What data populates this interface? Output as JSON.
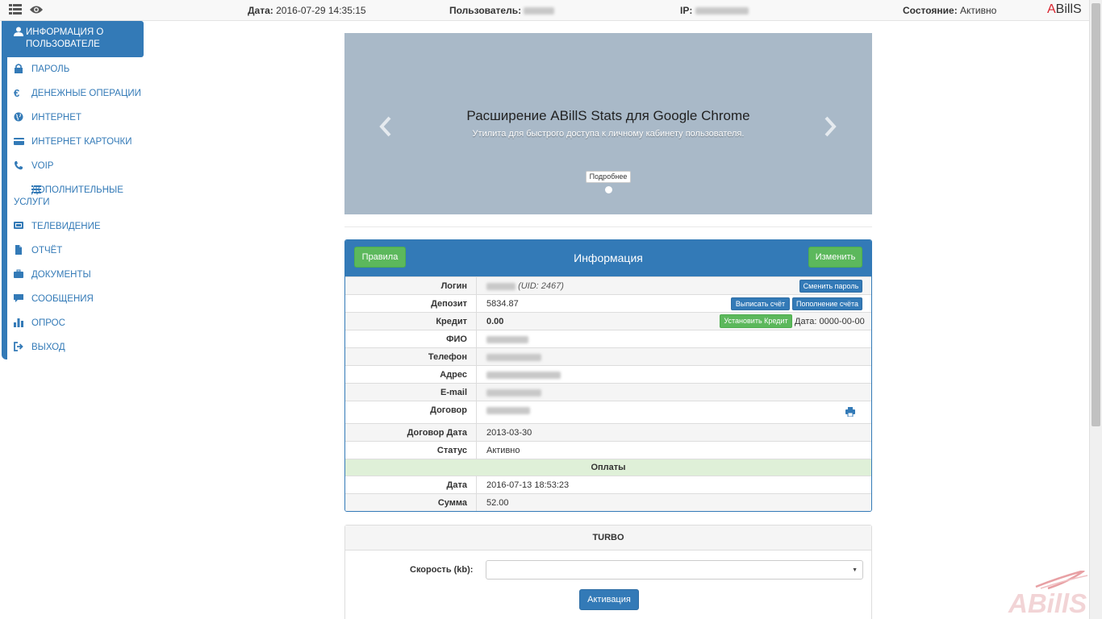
{
  "topbar": {
    "date_label": "Дата:",
    "date_value": "2016-07-29 14:35:15",
    "user_label": "Пользователь:",
    "ip_label": "IP:",
    "status_label": "Состояние:",
    "status_value": "Активно",
    "logo_first": "A",
    "logo_rest": "BillS"
  },
  "sidebar": {
    "active": "ИНФОРМАЦИЯ О ПОЛЬЗОВАТЕЛЕ",
    "items": [
      "ПАРОЛЬ",
      "ДЕНЕЖНЫЕ ОПЕРАЦИИ",
      "ИНТЕРНЕТ",
      "ИНТЕРНЕТ КАРТОЧКИ",
      "VOIP",
      "ДОПОЛНИТЕЛЬНЫЕ УСЛУГИ",
      "ТЕЛЕВИДЕНИЕ",
      "ОТЧЁТ",
      "ДОКУМЕНТЫ",
      "СООБЩЕНИЯ",
      "ОПРОС",
      "ВЫХОД"
    ]
  },
  "carousel": {
    "title": "Расширение ABillS Stats для Google Chrome",
    "subtitle": "Утилита для быстрого доступа к личному кабинету пользователя.",
    "button": "Подробнее"
  },
  "info": {
    "title": "Информация",
    "rules_button": "Правила",
    "edit_button": "Изменить",
    "change_password": "Сменить пароль",
    "write_invoice": "Выписать счёт",
    "topup": "Пополнение счёта",
    "set_credit": "Установить Кредит",
    "credit_date": "Дата: 0000-00-00",
    "rows": {
      "login": "Логин",
      "uid": "(UID: 2467)",
      "deposit": "Депозит",
      "deposit_value": "5834.87",
      "credit": "Кредит",
      "credit_value": "0.00",
      "fio": "ФИО",
      "phone": "Телефон",
      "address": "Адрес",
      "email": "E-mail",
      "contract": "Договор",
      "contract_date": "Договор Дата",
      "contract_date_value": "2013-03-30",
      "status": "Статус",
      "status_value": "Активно",
      "payments": "Оплаты",
      "pay_date": "Дата",
      "pay_date_value": "2016-07-13 18:53:23",
      "sum": "Сумма",
      "sum_value": "52.00"
    }
  },
  "turbo": {
    "title": "TURBO",
    "speed_label": "Скорость (kb):",
    "activate": "Активация"
  },
  "watermark": "ABillS",
  "colors": {
    "primary": "#337ab7",
    "success": "#5cb85c",
    "carousel_bg": "#a9b9c8",
    "logo_red": "#d9232e"
  }
}
